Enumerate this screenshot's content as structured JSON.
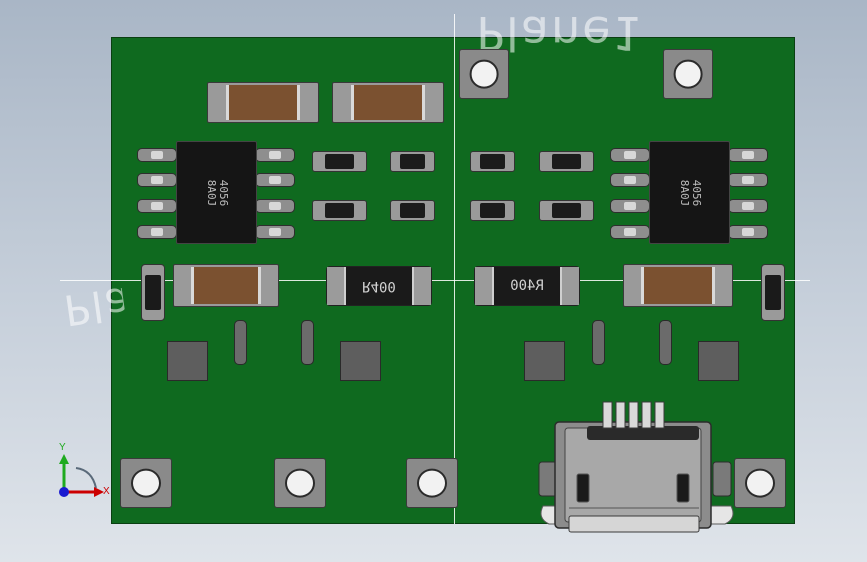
{
  "viewport": {
    "plane_labels": [
      "Plane1",
      "Pla"
    ]
  },
  "components": {
    "resistor_label_left": "R400",
    "resistor_label_right": "R400",
    "ic_left_marking": "4056\n8A0J",
    "ic_right_marking": "4056\n8A0J"
  },
  "triad": {
    "y_label": "Y",
    "x_label": "X"
  },
  "colors": {
    "pcb": "#0f6a1f",
    "background_top": "#a9b6c6",
    "background_bottom": "#dfe4ea",
    "axis_x": "#cc0000",
    "axis_y": "#1faa1f",
    "axis_z": "#1a1ad0"
  }
}
